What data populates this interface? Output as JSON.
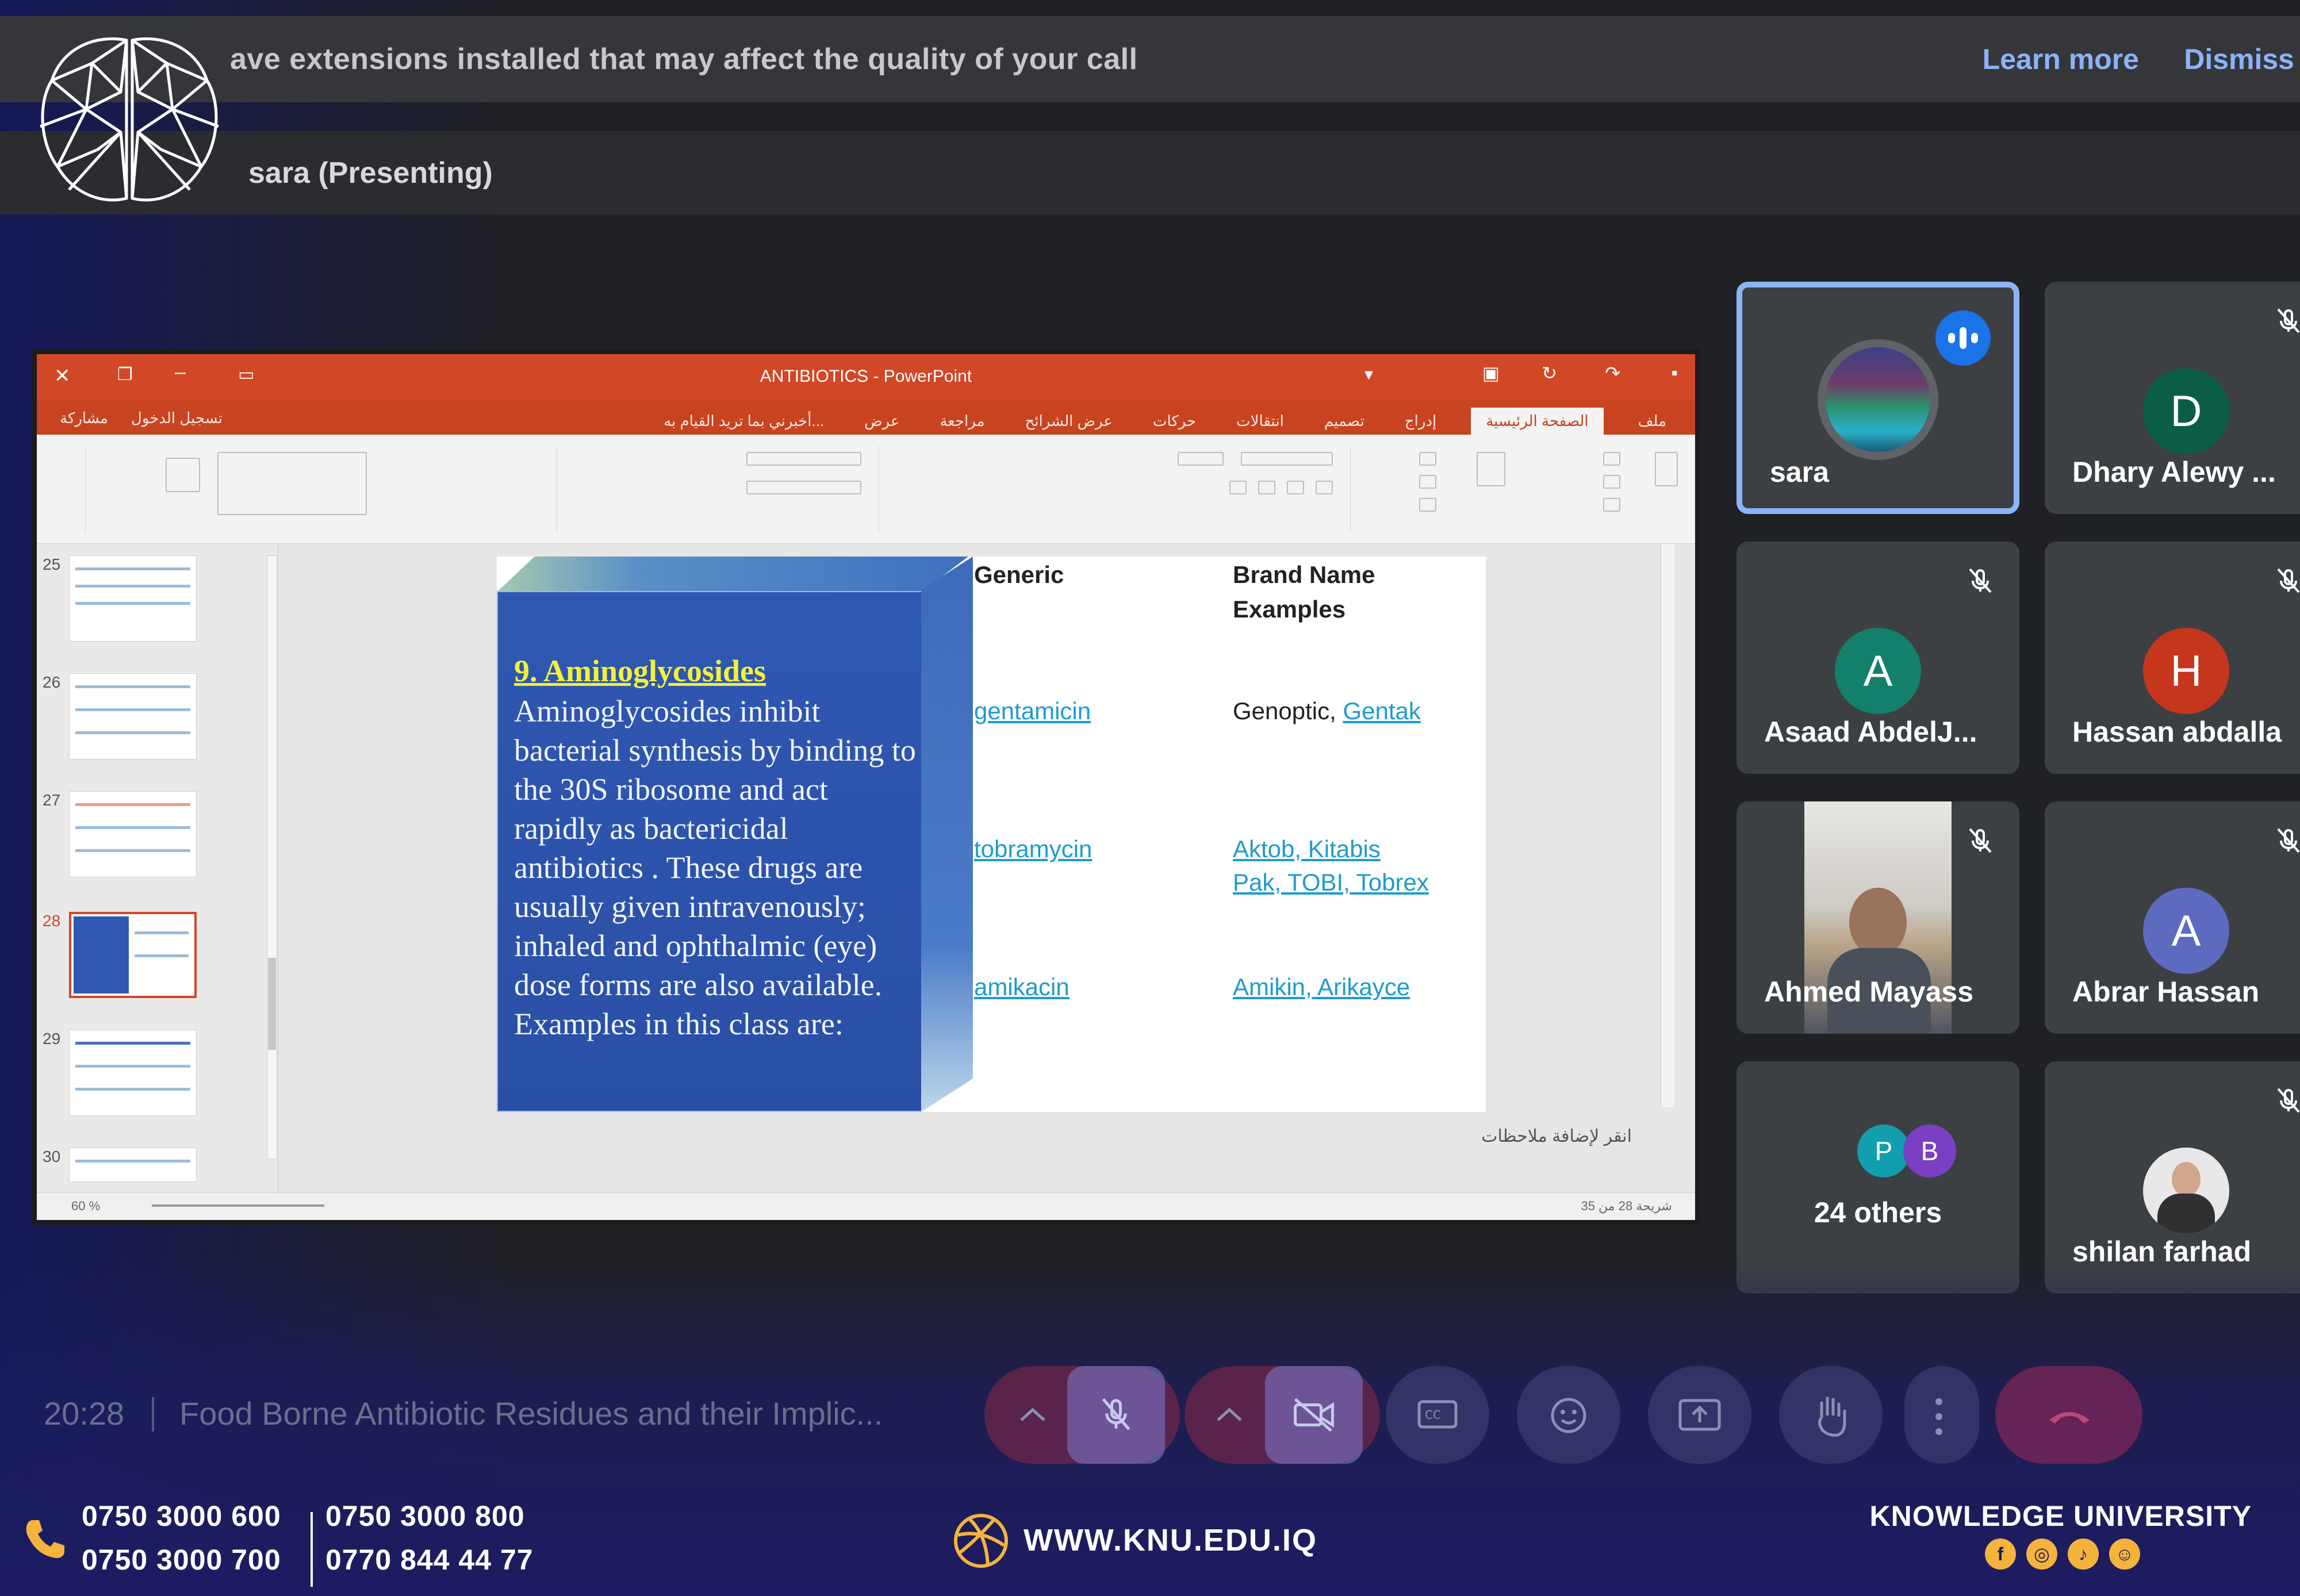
{
  "banner": {
    "message": "ave extensions installed that may affect the quality of your call",
    "learn_more": "Learn more",
    "dismiss": "Dismiss"
  },
  "presenting": "sara (Presenting)",
  "powerpoint": {
    "window_title": "ANTIBIOTICS - PowerPoint",
    "tabs": [
      "ملف",
      "الصفحة الرئيسية",
      "إدراج",
      "تصميم",
      "انتقالات",
      "حركات",
      "عرض الشرائح",
      "مراجعة",
      "عرض"
    ],
    "tell_me": "أخبرني بما تريد القيام به...",
    "sign_in": "تسجيل الدخول",
    "share": "مشاركة",
    "thumbnails": [
      "25",
      "26",
      "27",
      "28",
      "29",
      "30"
    ],
    "selected_thumbnail": "28",
    "notes_hint": "انقر لإضافة ملاحظات",
    "status_left": "شريحة 28 من 35",
    "zoom": "60 %"
  },
  "slide": {
    "heading": "9. Aminoglycosides",
    "body": "Aminoglycosides inhibit bacterial synthesis by binding to the 30S ribosome and act rapidly as bactericidal antibiotics . These drugs are usually given intravenously; inhaled and ophthalmic (eye) dose forms are also available. Examples in this class are:",
    "table": {
      "col_generic": "Generic",
      "col_brand_1": "Brand Name",
      "col_brand_2": "Examples",
      "rows": [
        {
          "generic": "gentamicin",
          "brand_plain": "Genoptic, ",
          "brand_links": [
            "Gentak"
          ]
        },
        {
          "generic": "tobramycin",
          "brand_line1": "Aktob, Kitabis",
          "brand_line2": "Pak, TOBI, Tobrex"
        },
        {
          "generic": "amikacin",
          "brand_line1": "Amikin, Arikayce"
        }
      ]
    }
  },
  "participants": [
    {
      "name": "sara",
      "initial": "",
      "speaking": true,
      "color": "#3c4043"
    },
    {
      "name": "Dhary Alewy ...",
      "initial": "D",
      "muted": true,
      "color": "#0b5e45"
    },
    {
      "name": "Asaad AbdelJ...",
      "initial": "A",
      "muted": true,
      "color": "#12806b"
    },
    {
      "name": "Hassan abdalla",
      "initial": "H",
      "muted": true,
      "color": "#c5361c"
    },
    {
      "name": "Ahmed Mayass",
      "initial": "",
      "muted": true,
      "color": "#3c4043"
    },
    {
      "name": "Abrar Hassan",
      "initial": "A",
      "muted": true,
      "color": "#5c6bc0"
    },
    {
      "name": "24 others",
      "initials": [
        "P",
        "B"
      ],
      "colors": [
        "#129eaf",
        "#7b3fc4"
      ]
    },
    {
      "name": "shilan farhad",
      "initial": "",
      "muted": true,
      "color": "#3c4043"
    }
  ],
  "meeting": {
    "time": "20:28",
    "title": "Food Borne Antibiotic Residues and their Implic..."
  },
  "footer": {
    "phone1": "0750 3000 600",
    "phone2": "0750 3000 700",
    "phone3": "0750 3000 800",
    "phone4": "0770 844 44 77",
    "website": "WWW.KNU.EDU.IQ",
    "university": "KNOWLEDGE UNIVERSITY",
    "socials": [
      "f",
      "ig",
      "tt",
      "sc"
    ]
  },
  "colors": {
    "accent_blue": "#8ab4f8",
    "ppt_orange": "#d24726",
    "brand_navy": "#1d1c63",
    "brand_gold": "#f4b33d"
  }
}
